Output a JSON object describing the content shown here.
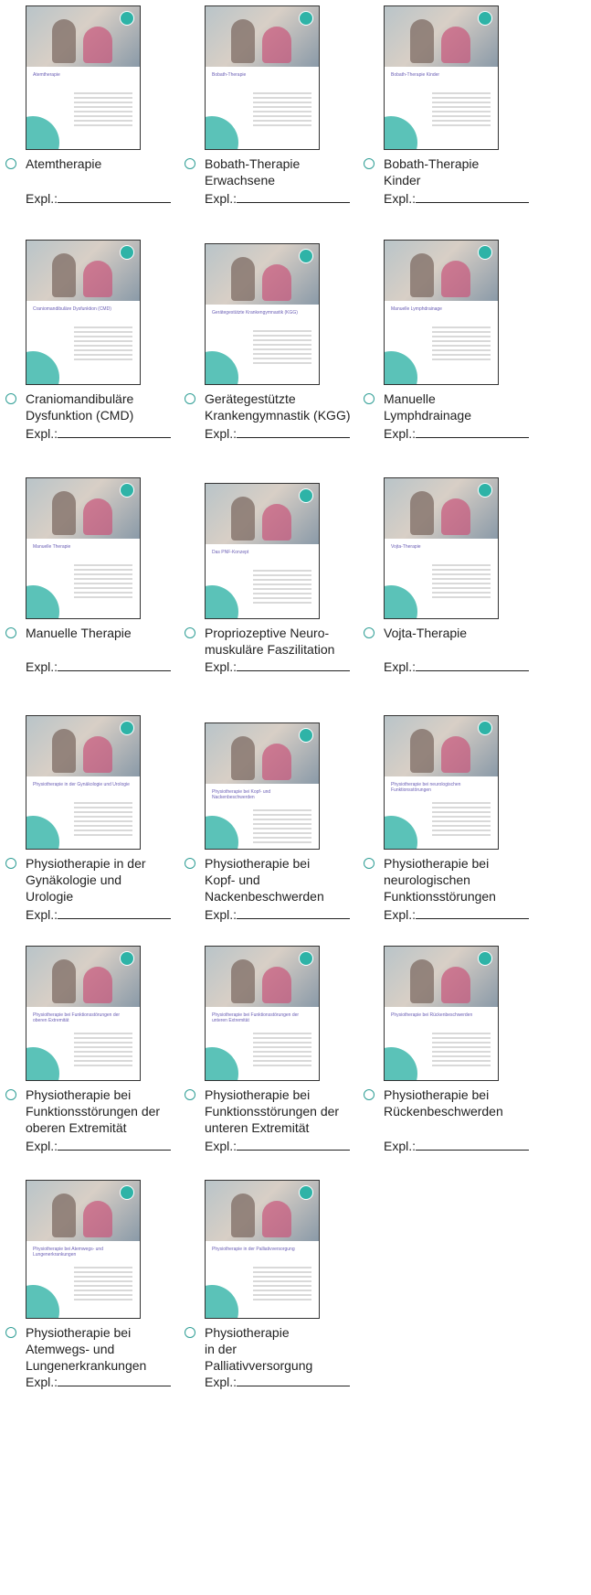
{
  "expl_label": "Expl.:",
  "colors": {
    "accent": "#2eb3a7",
    "title_purple": "#6b5fb5",
    "circle": "#5bc2b8"
  },
  "items": [
    {
      "label": "Atemtherapie",
      "brochure_title": "Atemtherapie"
    },
    {
      "label": "Bobath-Therapie\nErwachsene",
      "brochure_title": "Bobath-Therapie"
    },
    {
      "label": "Bobath-Therapie\nKinder",
      "brochure_title": "Bobath-Therapie Kinder"
    },
    {
      "label": "Craniomandibuläre\nDysfunktion (CMD)",
      "brochure_title": "Craniomandibuläre Dysfunktion (CMD)"
    },
    {
      "label": "Gerätegestützte\nKrankengymnastik (KGG)",
      "brochure_title": "Gerätegestützte Krankengymnastik (KGG)"
    },
    {
      "label": "Manuelle\nLymphdrainage",
      "brochure_title": "Manuelle Lymphdrainage"
    },
    {
      "label": "Manuelle Therapie",
      "brochure_title": "Manuelle Therapie"
    },
    {
      "label": "Propriozeptive Neuro-\nmuskuläre Faszilitation",
      "brochure_title": "Das PNF-Konzept"
    },
    {
      "label": "Vojta-Therapie",
      "brochure_title": "Vojta-Therapie"
    },
    {
      "label": "Physiotherapie in der\nGynäkologie und\nUrologie",
      "brochure_title": "Physiotherapie in der Gynäkologie und Urologie"
    },
    {
      "label": "Physiotherapie bei\nKopf- und\nNackenbeschwerden",
      "brochure_title": "Physiotherapie bei Kopf- und Nackenbeschwerden"
    },
    {
      "label": "Physiotherapie bei\nneurologischen\nFunktionsstörungen",
      "brochure_title": "Physiotherapie bei neurologischen Funktionsstörungen"
    },
    {
      "label": "Physiotherapie bei\nFunktionsstörungen der\noberen Extremität",
      "brochure_title": "Physiotherapie bei Funktionsstörungen der oberen Extremität"
    },
    {
      "label": "Physiotherapie bei\nFunktionsstörungen der\nunteren Extremität",
      "brochure_title": "Physiotherapie bei Funktionsstörungen der unteren Extremität"
    },
    {
      "label": "Physiotherapie bei\nRückenbeschwerden",
      "brochure_title": "Physiotherapie bei Rückenbeschwerden"
    },
    {
      "label": "Physiotherapie bei\nAtemwegs- und\nLungenerkrankungen",
      "brochure_title": "Physiotherapie bei Atemwegs- und Lungenerkrankungen"
    },
    {
      "label": "Physiotherapie\nin der\nPalliativversorgung",
      "brochure_title": "Physiotherapie in der Palliativversorgung"
    }
  ]
}
